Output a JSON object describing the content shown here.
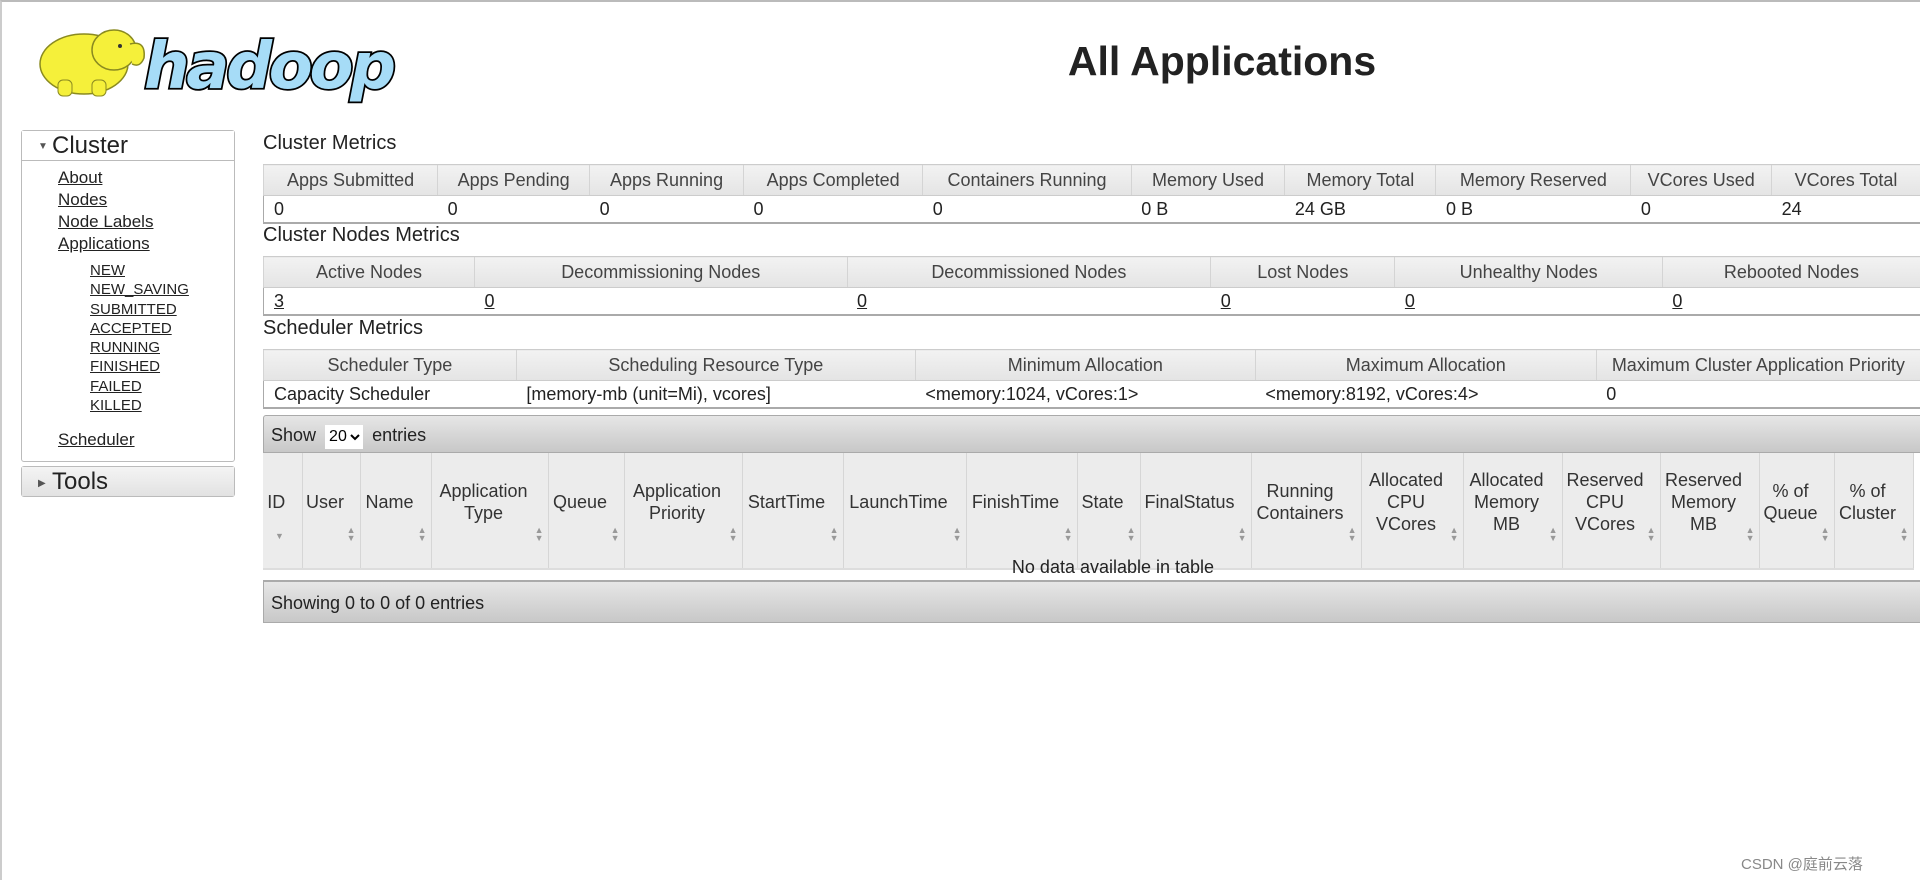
{
  "logo": {
    "text": "hadoop"
  },
  "page_title": "All Applications",
  "nav": {
    "cluster": {
      "label": "Cluster",
      "links": [
        "About",
        "Nodes",
        "Node Labels",
        "Applications"
      ],
      "app_states": [
        "NEW",
        "NEW_SAVING",
        "SUBMITTED",
        "ACCEPTED",
        "RUNNING",
        "FINISHED",
        "FAILED",
        "KILLED"
      ],
      "scheduler": "Scheduler"
    },
    "tools": {
      "label": "Tools"
    }
  },
  "cluster_metrics": {
    "title": "Cluster Metrics",
    "headers": [
      "Apps Submitted",
      "Apps Pending",
      "Apps Running",
      "Apps Completed",
      "Containers Running",
      "Memory Used",
      "Memory Total",
      "Memory Reserved",
      "VCores Used",
      "VCores Total"
    ],
    "values": [
      "0",
      "0",
      "0",
      "0",
      "0",
      "0 B",
      "24 GB",
      "0 B",
      "0",
      "24"
    ]
  },
  "nodes_metrics": {
    "title": "Cluster Nodes Metrics",
    "headers": [
      "Active Nodes",
      "Decommissioning Nodes",
      "Decommissioned Nodes",
      "Lost Nodes",
      "Unhealthy Nodes",
      "Rebooted Nodes"
    ],
    "values": [
      "3",
      "0",
      "0",
      "0",
      "0",
      "0"
    ]
  },
  "scheduler_metrics": {
    "title": "Scheduler Metrics",
    "headers": [
      "Scheduler Type",
      "Scheduling Resource Type",
      "Minimum Allocation",
      "Maximum Allocation",
      "Maximum Cluster Application Priority"
    ],
    "values": [
      "Capacity Scheduler",
      "[memory-mb (unit=Mi), vcores]",
      "<memory:1024, vCores:1>",
      "<memory:8192, vCores:4>",
      "0"
    ]
  },
  "apps_table": {
    "show_label": "Show",
    "page_size": "20",
    "entries_label": "entries",
    "columns": [
      "ID",
      "User",
      "Name",
      "Application Type",
      "Queue",
      "Application Priority",
      "StartTime",
      "LaunchTime",
      "FinishTime",
      "State",
      "FinalStatus",
      "Running Containers",
      "Allocated CPU VCores",
      "Allocated Memory MB",
      "Reserved CPU VCores",
      "Reserved Memory MB",
      "% of Queue",
      "% of Cluster"
    ],
    "empty_message": "No data available in table",
    "info": "Showing 0 to 0 of 0 entries"
  },
  "watermark": "CSDN @庭前云落"
}
